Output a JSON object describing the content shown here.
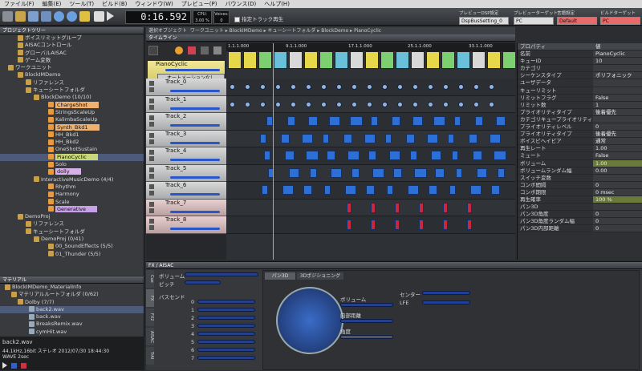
{
  "menu": [
    "ファイル(F)",
    "編集(E)",
    "ツール(T)",
    "ビルド(B)",
    "ウィンドウ(W)",
    "プレビュー(P)",
    "バウンス(D)",
    "ヘルプ(H)"
  ],
  "toolbar": {
    "time": "0:16.592",
    "cpu_label": "CPU: 3.00 %",
    "voices_label": "Voices: 0",
    "solo_label": "指定トラック再生",
    "dsp_label": "プレビューDSP設定",
    "dsp_value": "DspBusSetting_0",
    "target_label": "プレビューターゲット",
    "target_value": "PC",
    "lang_label": "言語設定",
    "lang_value": "Default",
    "build_label": "ビルドターゲット",
    "build_value": "PC"
  },
  "project": {
    "title": "プロジェクトツリー",
    "items": [
      "ボイスリミットグループ",
      "AISACコントロール",
      "グローバルAISAC",
      "ゲーム変数",
      "ワークユニット",
      "BlockIMDemo",
      "リファレンス",
      "キューシートフォルダ",
      "BlockDemo (10/10)",
      "ChargeShot",
      "StringsScaleUp",
      "KalimbaScaleUp",
      "Synth_Bkd1",
      "HH_Bkd1",
      "HH_Bkd2",
      "OneShotSustain",
      "PianoCyclic",
      "Solo",
      "dolly",
      "InteractiveMusicDemo (4/4)",
      "Rhythm",
      "Harmony",
      "Scale",
      "Generative",
      "DemoProj",
      "リファレンス",
      "キューシートフォルダ",
      "DemoProj (0/41)",
      "00_SoundEffects (5/5)",
      "01_Thunder (5/5)"
    ]
  },
  "material": {
    "title": "マテリアル",
    "items": [
      "BlockIMDemo_MaterialInfo",
      "マテリアルルートフォルダ (0/62)",
      "Dolby (7/7)",
      "back2.wav",
      "back.wav",
      "BreaksRemix.wav",
      "cymHit.wav"
    ]
  },
  "info": {
    "file": "back2.wav",
    "line1": "44.1kHz,16bit ステレオ 2012/07/30 18:44:30",
    "line2": "WAVE 2sec"
  },
  "center": {
    "tab": "選択オブジェクト",
    "crumb": "ワークユニット ▸ BlockIMDemo ▸ キューシートフォルダ ▸ BlockDemo ▸ PianoCyclic",
    "timeline_title": "タイムライン",
    "cue_name": "PianoCyclic",
    "automation": "オートメーションなし",
    "ruler": [
      "1.1.1.000",
      "9.1.1.000",
      "17.1.1.000",
      "25.1.1.000",
      "33.1.1.000"
    ],
    "cue_start": "0.1",
    "tracks": [
      "Track_0",
      "Track_1",
      "Track_2",
      "Track_3",
      "Track_4",
      "Track_5",
      "Track_6",
      "Track_7",
      "Track_8"
    ]
  },
  "props": {
    "title": "プロパティ",
    "header_value": "値",
    "rows": [
      [
        "名前",
        "PianoCyclic"
      ],
      [
        "キューID",
        "10"
      ],
      [
        "カテゴリ",
        ""
      ],
      [
        "シーケンスタイプ",
        "ポリフォニック"
      ],
      [
        "ユーザデータ",
        ""
      ],
      [
        "キューリミット",
        ""
      ],
      [
        "リミットフラグ",
        "False"
      ],
      [
        "リミット数",
        "1"
      ],
      [
        "プライオリティタイプ",
        "後着優先"
      ],
      [
        "カテゴリキュープライオリティ",
        ""
      ],
      [
        "プライオリティレベル",
        "0"
      ],
      [
        "プライオリティタイプ",
        "後着優先"
      ],
      [
        "ボイスビヘイビア",
        "通常"
      ],
      [
        "再生レート",
        "1.00"
      ],
      [
        "ミュート",
        "False"
      ],
      [
        "ボリューム",
        "1.00"
      ],
      [
        "ボリュームランダム幅",
        "0.00"
      ],
      [
        "スイッチ変数",
        ""
      ],
      [
        "コンボ間隔",
        "0"
      ],
      [
        "コンボ期限",
        "0 msec"
      ],
      [
        "再生確率",
        "100 %"
      ],
      [
        "パン3D",
        ""
      ],
      [
        "パン3D角度",
        "0"
      ],
      [
        "パン3D角度ランダム幅",
        "0"
      ],
      [
        "パン3D内部距離",
        "0"
      ]
    ]
  },
  "fx": {
    "title": "FX / AISAC",
    "volume": "ボリューム",
    "pitch": "ピッチ",
    "send": "バスセンド",
    "tab1": "パン3D",
    "tab2": "3Dポジショニング",
    "pan_volume": "ボリューム",
    "inner": "内部距離",
    "angle": "角度",
    "center": "センター",
    "lfe": "LFE",
    "bus": [
      "0",
      "1",
      "2",
      "3",
      "4",
      "5",
      "6",
      "7"
    ],
    "side": [
      "Cue",
      "FX",
      "FX2",
      "AISAC",
      "TrAI"
    ]
  }
}
